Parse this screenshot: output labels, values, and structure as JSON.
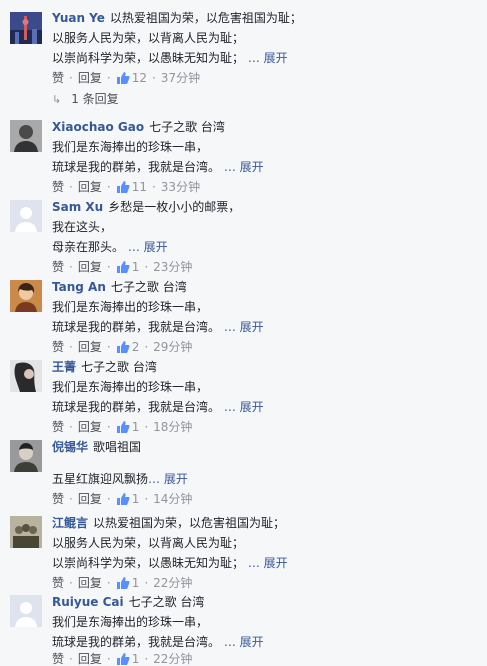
{
  "labels": {
    "like": "赞",
    "reply": "回复",
    "more": "展开",
    "ellipsis": "…"
  },
  "colors": {
    "link": "#365899",
    "text": "#1d2129",
    "meta": "#90949c",
    "background": "#f6f7f9"
  },
  "comments": [
    {
      "author": "Yuan Ye",
      "lines": [
        "以热爱祖国为荣，以危害祖国为耻；",
        "以服务人民为荣，以背离人民为耻；",
        "以崇尚科学为荣，以愚昧无知为耻；"
      ],
      "likes": "12",
      "time": "37分钟",
      "replies_label": "1 条回复",
      "avatar_icon": "city-skyline-avatar"
    },
    {
      "author": "Xiaochao Gao",
      "lines": [
        "七子之歌 台湾",
        "我们是东海捧出的珍珠一串，",
        "琉球是我的群弟，我就是台湾。"
      ],
      "likes": "11",
      "time": "33分钟",
      "avatar_icon": "person-portrait-avatar"
    },
    {
      "author": "Sam Xu",
      "lines": [
        "乡愁是一枚小小的邮票，",
        "我在这头，",
        "母亲在那头。"
      ],
      "likes": "1",
      "time": "23分钟",
      "avatar_icon": "default-avatar"
    },
    {
      "author": "Tang An",
      "lines": [
        "七子之歌 台湾",
        "我们是东海捧出的珍珠一串，",
        "琉球是我的群弟，我就是台湾。"
      ],
      "likes": "2",
      "time": "29分钟",
      "avatar_icon": "woman-portrait-avatar"
    },
    {
      "author": "王菁",
      "lines": [
        "七子之歌 台湾",
        "我们是东海捧出的珍珠一串，",
        "琉球是我的群弟，我就是台湾。"
      ],
      "likes": "1",
      "time": "18分钟",
      "avatar_icon": "woman-profile-avatar"
    },
    {
      "author": "倪锡华",
      "lines": [
        "歌唱祖国",
        "",
        "五星红旗迎风飘扬"
      ],
      "likes": "1",
      "time": "14分钟",
      "avatar_icon": "portrait-avatar"
    },
    {
      "author": "江鲲言",
      "lines": [
        "以热爱祖国为荣，以危害祖国为耻；",
        "以服务人民为荣，以背离人民为耻；",
        "以崇尚科学为荣，以愚昧无知为耻；"
      ],
      "likes": "1",
      "time": "22分钟",
      "avatar_icon": "group-portrait-avatar"
    },
    {
      "author": "Ruiyue Cai",
      "lines": [
        "七子之歌 台湾",
        "我们是东海捧出的珍珠一串，",
        "琉球是我的群弟，我就是台湾。"
      ],
      "likes": "1",
      "time": "22分钟",
      "avatar_icon": "default-avatar"
    }
  ]
}
